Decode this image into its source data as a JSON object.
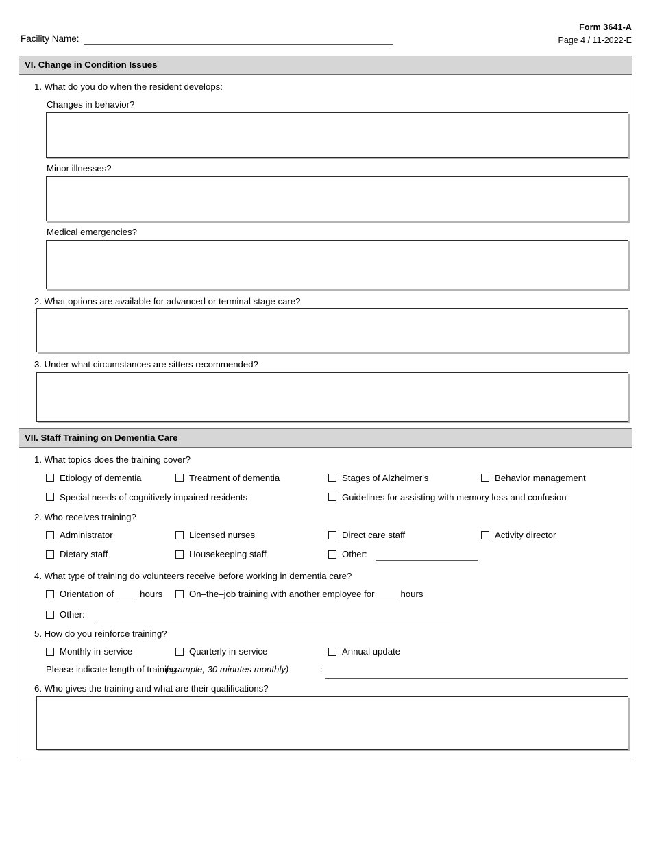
{
  "header": {
    "form_id": "Form 3641-A",
    "page_info": "Page 4 / 11-2022-E",
    "facility_label": "Facility Name:"
  },
  "section_vi": {
    "title": "VI. Change in Condition Issues",
    "q1": {
      "text": "1. What do you do when the resident develops:",
      "sub": [
        {
          "label": "Changes in behavior?",
          "answer": ""
        },
        {
          "label": "Minor illnesses?",
          "answer": ""
        },
        {
          "label": "Medical emergencies?",
          "answer": ""
        }
      ]
    },
    "q2": {
      "text": "2. What options are available for advanced or terminal stage care?",
      "answer": ""
    },
    "q3": {
      "text": "3. Under what circumstances are sitters recommended?",
      "answer": ""
    }
  },
  "section_vii": {
    "title": "VII. Staff Training on Dementia Care",
    "q1": {
      "text": "1. What topics does the training cover?",
      "row1": [
        "Etiology of dementia",
        "Treatment of dementia",
        "Stages of Alzheimer's",
        "Behavior management"
      ],
      "row2": [
        "Special needs of cognitively impaired residents",
        "Guidelines for assisting with memory loss and confusion"
      ]
    },
    "q2": {
      "text": "2. Who receives training?",
      "row1": [
        "Administrator",
        "Licensed nurses",
        "Direct care staff",
        "Activity director"
      ],
      "row2": [
        "Dietary staff",
        "Housekeeping staff",
        "Other:"
      ],
      "other_value": ""
    },
    "q4": {
      "text": "4. What type of training do volunteers receive before working in dementia care?",
      "orientation_label": "Orientation of",
      "orientation_hours_value": "",
      "orientation_hours_unit": "hours",
      "onjob_label": "On–the–job training with another employee for",
      "onjob_hours_value": "",
      "onjob_hours_unit": "hours",
      "other_label": "Other:",
      "other_value": ""
    },
    "q5": {
      "text": "5. How do you reinforce training?",
      "options": [
        "Monthly in-service",
        "Quarterly in-service",
        "Annual update"
      ],
      "length_label": "Please indicate length of training",
      "length_example": "(example, 30 minutes monthly)",
      "length_colon": ":",
      "length_value": ""
    },
    "q6": {
      "text": "6. Who gives the training and what are their qualifications?",
      "answer": ""
    }
  }
}
